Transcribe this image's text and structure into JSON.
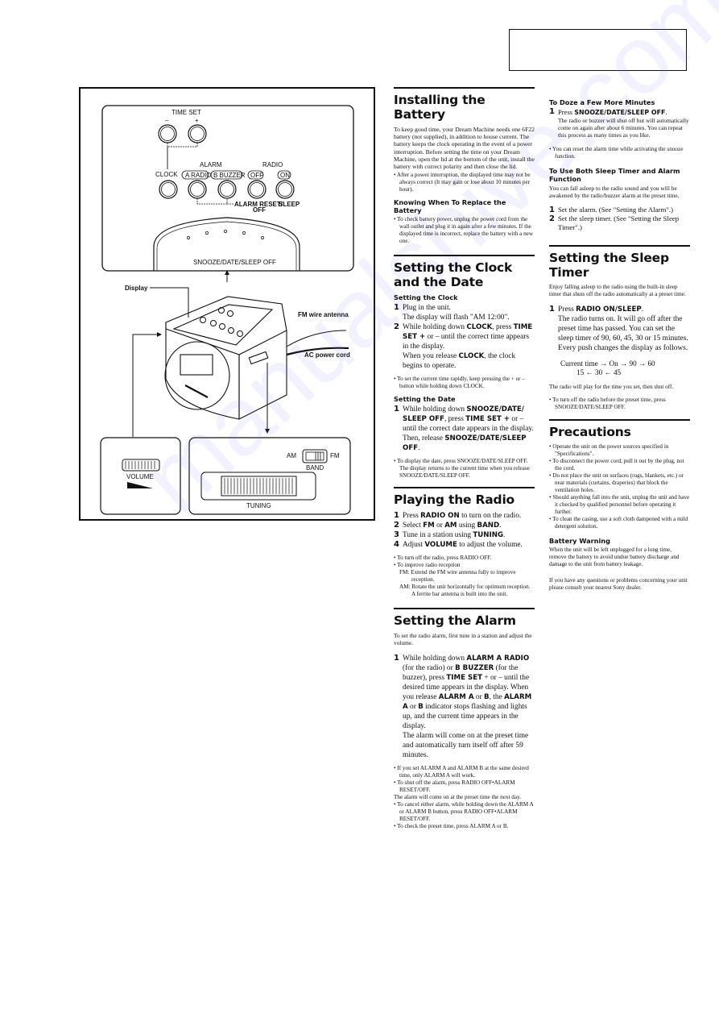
{
  "header_box": {
    "label": ""
  },
  "watermark": "manualshive.com",
  "diagram": {
    "time_set": "TIME SET",
    "minus": "–",
    "plus": "+",
    "clock": "CLOCK",
    "alarm": "ALARM",
    "radio": "RADIO",
    "a_radio": "A RADIO",
    "b_buzzer": "B BUZZER",
    "off": "OFF",
    "on": "ON",
    "alarm_reset": "ALARM RESET/",
    "alarm_reset_off": "OFF",
    "sleep": "SLEEP",
    "snooze": "SNOOZE/DATE/SLEEP OFF",
    "display": "Display",
    "fm_antenna": "FM wire antenna",
    "ac_cord": "AC power cord",
    "volume": "VOLUME",
    "am": "AM",
    "fm": "FM",
    "band": "BAND",
    "tuning": "TUNING"
  },
  "battery": {
    "title": "Installing the Battery",
    "intro": "To keep good time, your Dream Machine needs one 6F22 battery (not supplied), in addition to house current. The battery keeps the clock operating in the event of a power interruption. Before setting the time on your Dream Machine, open the lid at the bottom of the unit, install the battery with correct polarity and then close the lid.",
    "note": "• After a power interruption, the displayed time may not be always correct (It may gain or lose about 10 minutes per hour).",
    "replace_title": "Knowing When To Replace the Battery",
    "replace_note": "• To check battery power, unplug the power cord from the wall outlet and plug it in again after a few minutes. If the displayed time is incorrect, replace the battery with a new one."
  },
  "clock": {
    "title": "Setting the Clock and the Date",
    "clock_sub": "Setting the Clock",
    "s1": "Plug in the unit.",
    "s1b": "The display will flash \"AM 12:00\".",
    "s2a": "While holding down ",
    "s2b": "CLOCK",
    "s2c": ", press ",
    "s2d": "TIME SET +",
    "s2e": " or – until the correct time appears in the display.",
    "s2f": "When you release ",
    "s2g": "CLOCK",
    "s2h": ", the clock begins to operate.",
    "note": "• To set the current time rapidly, keep pressing the + or – button while holding down CLOCK.",
    "date_sub": "Setting the Date",
    "d1a": "While holding down ",
    "d1b": "SNOOZE/DATE/ SLEEP OFF",
    "d1c": ", press ",
    "d1d": "TIME SET +",
    "d1e": " or – until the correct date appears in the display. Then, release ",
    "d1f": "SNOOZE/DATE/SLEEP OFF",
    "d1g": ".",
    "date_note": "• To display the date, press SNOOZE/DATE/SLEEP OFF. The display returns to the current time when you release  SNOOZE/DATE/SLEEP OFF."
  },
  "radio": {
    "title": "Playing the Radio",
    "steps": [
      {
        "n": "1",
        "a": "Press ",
        "b": "RADIO ON",
        "c": " to turn on the radio."
      },
      {
        "n": "2",
        "a": "Select ",
        "b": "FM",
        "c": " or ",
        "d": "AM",
        "e": " using ",
        "f": "BAND",
        "g": "."
      },
      {
        "n": "3",
        "a": "Tune in a station using ",
        "b": "TUNING",
        "c": "."
      },
      {
        "n": "4",
        "a": "Adjust ",
        "b": "VOLUME",
        "c": " to adjust the volume."
      }
    ],
    "note1": "• To turn off the radio, press RADIO OFF.",
    "note2": "• To improve radio reception",
    "fm": "FM: Extend the FM wire antenna fully to improve reception.",
    "am": "AM: Rotate the unit horizontally for optimum reception. A ferrite bar antenna is built into the unit."
  },
  "alarm": {
    "title": "Setting the Alarm",
    "intro": "To set the radio alarm, first tune in a station and adjust the volume.",
    "s1a": "While holding down ",
    "s1b": "ALARM A RADIO",
    "s1c": " (for the radio) or ",
    "s1d": "B BUZZER",
    "s1e": " (for the buzzer), press ",
    "s1f": "TIME SET",
    "s1g": " + or – until the desired time appears in the display. When you release ",
    "s1h": "ALARM A",
    "s1i": " or ",
    "s1j": "B",
    "s1k": ", the ",
    "s1l": "ALARM A",
    "s1m": " or ",
    "s1n": "B",
    "s1o": " indicator stops flashing and lights up, and the current time appears in the display.",
    "s1p": "The alarm will come on at the preset time and automatically turn itself off after 59 minutes.",
    "notes": [
      "• If you set ALARM A and ALARM B at the same desired time, only ALARM A will work.",
      "• To shut off the alarm, press RADIO OFF•ALARM RESET/OFF.",
      "The alarm will come on at the preset time the next day.",
      "• To cancel either alarm, while holding down the ALARM A or ALARM B button, press RADIO OFF•ALARM RESET/OFF.",
      "• To check the preset time, press ALARM A or B."
    ]
  },
  "doze": {
    "title": "To Doze a Few More Minutes",
    "s1a": "Press ",
    "s1b": "SNOOZE/DATE/SLEEP OFF",
    "s1c": ".",
    "detail": "The radio or buzzer will shut off but will automatically come on again after about 6 minutes.  You can repeat this process as many times as you like.",
    "note": "• You can reset the alarm time while activating the snooze function."
  },
  "both": {
    "title": "To Use Both Sleep Timer and Alarm Function",
    "intro": "You can fall asleep to the radio sound and you will be awakened by the radio/buzzer alarm at the preset time.",
    "s1": "Set the alarm. (See \"Setting the Alarm\".)",
    "s2": "Set the sleep timer. (See \"Setting the Sleep Timer\".)"
  },
  "sleep": {
    "title": "Setting the Sleep Timer",
    "intro": "Enjoy falling asleep to the radio using the built-in sleep timer that shuts off the radio automatically at a preset time.",
    "s1a": "Press ",
    "s1b": "RADIO ON/SLEEP",
    "s1c": ".",
    "s1d": "The radio turns on. It will go off after the preset time has passed. You can set the sleep timer of 90, 60, 45, 30 or 15 minutes.",
    "s1e": "Every push changes the display as follows.",
    "seq_top": "Current time → On → 90 → 60",
    "seq_bottom": "15 ← 30 ← 45",
    "after": "The radio will play for the time you set, then shut off.",
    "note": "• To turn off the radio before the preset time, press SNOOZE/DATE/SLEEP OFF."
  },
  "precautions": {
    "title": "Precautions",
    "items": [
      "• Operate the unit on the power sources specified in \"Specifications\".",
      "• To disconnect the power cord, pull it out by the plug, not the cord.",
      "• Do not place the unit on surfaces (rugs, blankets, etc.) or near materials (curtains, draperies) that block the ventilation holes.",
      "• Should anything fall into the unit, unplug the unit and have it checked by qualified personnel before operating it further.",
      "• To clean the casing, use a soft cloth dampened with a mild detergent solution."
    ],
    "warning_title": "Battery Warning",
    "warning": "When the unit will be left unplugged for a long time, remove the battery to avoid undue battery discharge and damage to the unit from battery leakage.",
    "contact": "If you have any questions or problems concerning your unit please consult your nearest Sony dealer."
  }
}
